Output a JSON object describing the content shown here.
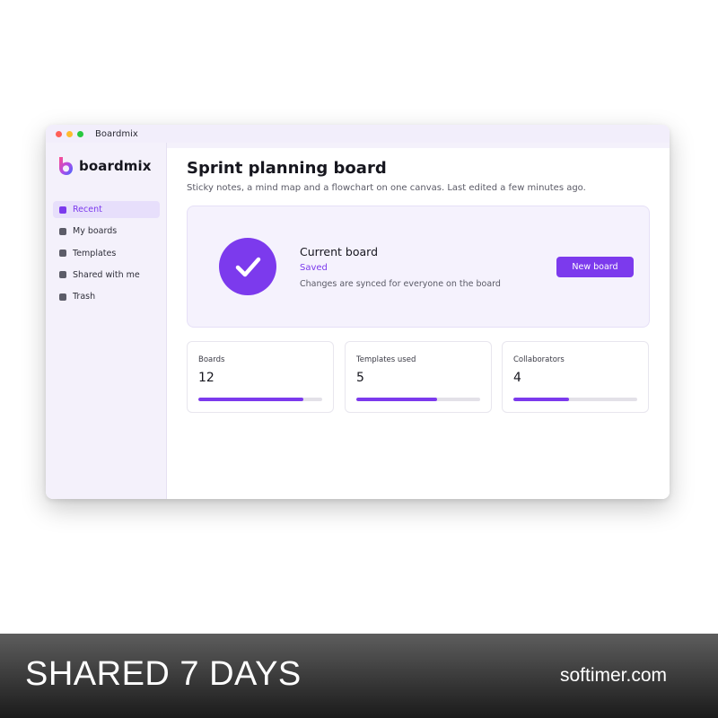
{
  "window": {
    "app_title": "Boardmix"
  },
  "sidebar": {
    "logo_text": "boardmix",
    "items": [
      {
        "label": "Recent",
        "active": true
      },
      {
        "label": "My boards",
        "active": false
      },
      {
        "label": "Templates",
        "active": false
      },
      {
        "label": "Shared with me",
        "active": false
      },
      {
        "label": "Trash",
        "active": false
      }
    ]
  },
  "main": {
    "title": "Sprint planning board",
    "subtitle": "Sticky notes, a mind map and a flowchart on one canvas. Last edited a few minutes ago.",
    "status_card": {
      "title": "Current board",
      "state": "Saved",
      "description": "Changes are synced for everyone on the board",
      "button_label": "New board",
      "icon": "check-icon"
    },
    "stats": [
      {
        "label": "Boards",
        "value": "12",
        "progress": 0.85
      },
      {
        "label": "Templates used",
        "value": "5",
        "progress": 0.65
      },
      {
        "label": "Collaborators",
        "value": "4",
        "progress": 0.45
      }
    ]
  },
  "banner": {
    "left_text": "SHARED 7 DAYS",
    "right_text": "softimer.com"
  },
  "colors": {
    "accent": "#7c3aed",
    "sidebar_bg": "#f4f1fb",
    "card_bg": "#f5f2fd"
  }
}
